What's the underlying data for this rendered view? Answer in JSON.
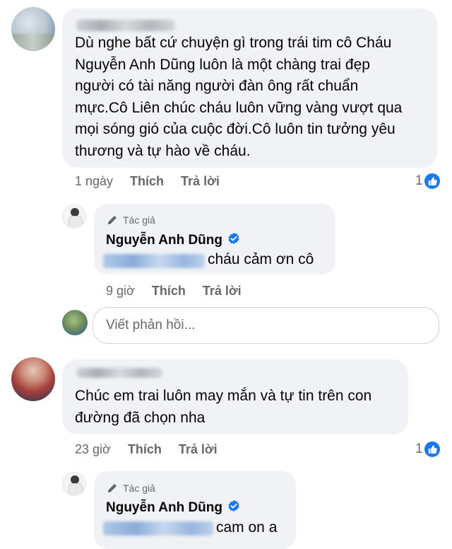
{
  "comments": [
    {
      "text_lines": [
        "Dù nghe bất cứ chuyện gì trong trái tim cô Cháu",
        "Nguyễn Anh Dũng luôn là một  chàng trai đẹp",
        "người có tài năng người đàn ông rất chuẩn",
        "mực.Cô Liên chúc cháu luôn vững vàng vượt qua",
        "mọi sóng gió của cuộc đời.Cô luôn tin tưởng yêu",
        "thương và tự hào về cháu."
      ],
      "time": "1 ngày",
      "like_label": "Thích",
      "reply_label": "Trả lời",
      "reaction_count": "1",
      "reply": {
        "author_badge": "Tác giả",
        "author_name": "Nguyễn Anh Dũng",
        "text": "cháu cảm ơn cô",
        "time": "9 giờ",
        "like_label": "Thích",
        "reply_label": "Trả lời"
      }
    },
    {
      "text_lines": [
        "Chúc em trai luôn may mắn và tự tin trên con",
        "đường đã chọn nha"
      ],
      "time": "23 giờ",
      "like_label": "Thích",
      "reply_label": "Trả lời",
      "reaction_count": "1",
      "reply": {
        "author_badge": "Tác giả",
        "author_name": "Nguyễn Anh Dũng",
        "text": "cam on a"
      }
    }
  ],
  "reply_box": {
    "placeholder": "Viết phản hồi..."
  },
  "colors": {
    "bubble": "#f0f2f5",
    "secondary_text": "#65676b",
    "accent": "#1877f2"
  }
}
